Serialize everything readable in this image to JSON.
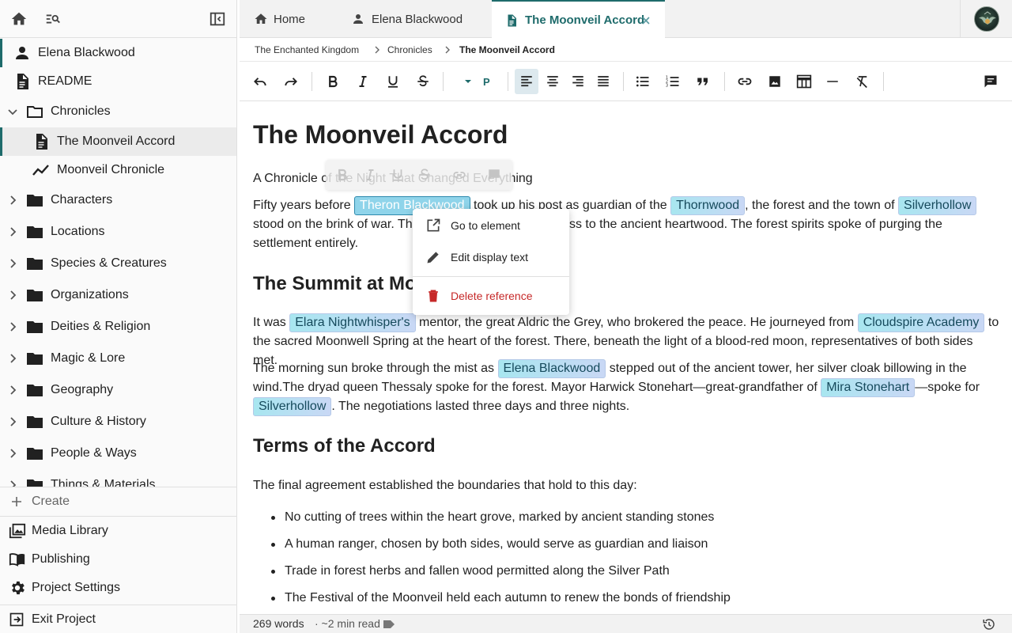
{
  "sidebar": {
    "home_icon": "home-icon",
    "search_icon": "search-tree-icon",
    "collapse_icon": "collapse-sidebar-icon",
    "items": [
      {
        "label": "Elena Blackwood",
        "icon": "person-icon"
      },
      {
        "label": "README",
        "icon": "document-icon"
      },
      {
        "label": "Chronicles",
        "icon": "folder-open-icon",
        "expanded": true
      },
      {
        "label": "The Moonveil Accord",
        "icon": "document-icon",
        "active": true
      },
      {
        "label": "Moonveil Chronicle",
        "icon": "timeline-icon"
      },
      {
        "label": "Characters",
        "icon": "folder-icon"
      },
      {
        "label": "Locations",
        "icon": "folder-icon"
      },
      {
        "label": "Species & Creatures",
        "icon": "folder-icon"
      },
      {
        "label": "Organizations",
        "icon": "folder-icon"
      },
      {
        "label": "Deities & Religion",
        "icon": "folder-icon"
      },
      {
        "label": "Magic & Lore",
        "icon": "folder-icon"
      },
      {
        "label": "Geography",
        "icon": "folder-icon"
      },
      {
        "label": "Culture & History",
        "icon": "folder-icon"
      },
      {
        "label": "People & Ways",
        "icon": "folder-icon"
      },
      {
        "label": "Things & Materials",
        "icon": "folder-icon"
      }
    ],
    "create_label": "Create",
    "bottom": [
      {
        "label": "Media Library",
        "icon": "image-library-icon"
      },
      {
        "label": "Publishing",
        "icon": "book-icon"
      },
      {
        "label": "Project Settings",
        "icon": "gear-icon"
      },
      {
        "label": "Exit Project",
        "icon": "exit-icon"
      }
    ]
  },
  "tabs": [
    {
      "label": "Home",
      "icon": "home-icon"
    },
    {
      "label": "Elena Blackwood",
      "icon": "person-icon"
    },
    {
      "label": "The Moonveil Accord",
      "icon": "document-icon",
      "active": true
    }
  ],
  "breadcrumb": [
    "The Enchanted Kingdom",
    "Chronicles",
    "The Moonveil Accord"
  ],
  "toolbar": {
    "style_value": "P",
    "buttons": [
      "undo",
      "redo",
      "bold",
      "italic",
      "underline",
      "strikethrough",
      "align-left",
      "align-center",
      "align-right",
      "align-justify",
      "bullet-list",
      "numbered-list",
      "quote",
      "link",
      "image",
      "table",
      "horizontal-rule",
      "clear-format",
      "comments"
    ],
    "active_button": "align-left"
  },
  "document": {
    "title": "The Moonveil Accord",
    "subtitle": "A Chronicle of the Night That Changed Everything",
    "p1": {
      "t1": "Fifty years before ",
      "ref1": "Theron Blackwood",
      "t2": " took up his post as guardian of the ",
      "ref2": "Thornwood",
      "t3": ", the forest and the town of ",
      "ref3": "Silverhollow",
      "t4": " stood on the brink of war. The townsfolk demanded access to the ancient heartwood. The forest spirits spoke of purging the settlement entirely."
    },
    "h2a": "The Summit at Moonwell",
    "p2": {
      "t1": "It was ",
      "ref1": "Elara Nightwhisper's",
      "t2": " mentor, the great Aldric the Grey, who brokered the peace. He journeyed from ",
      "ref2": "Cloudspire Academy",
      "t3": " to the sacred Moonwell Spring at the heart of the forest. There, beneath the light of a blood-red moon, representatives of both sides met."
    },
    "p3": {
      "t1": "The morning sun broke through the mist as ",
      "ref1": "Elena Blackwood",
      "t2": " stepped out of the ancient tower, her silver cloak billowing in the wind.The dryad queen Thessaly spoke for the forest. Mayor Harwick Stonehart—great-grandfather of ",
      "ref2": "Mira Stonehart",
      "t3": "—spoke for ",
      "ref3": "Silverhollow",
      "t4": ". The negotiations lasted three days and three nights."
    },
    "h2b": "Terms of the Accord",
    "p4": "The final agreement established the boundaries that hold to this day:",
    "bullets": [
      "No cutting of trees within the heart grove, marked by ancient standing stones",
      "A human ranger, chosen by both sides, would serve as guardian and liaison",
      "Trade in forest herbs and fallen wood permitted along the Silver Path",
      "The Festival of the Moonveil held each autumn to renew the bonds of friendship"
    ]
  },
  "context_menu": {
    "items": [
      {
        "label": "Go to element",
        "icon": "open-external-icon"
      },
      {
        "label": "Edit display text",
        "icon": "pencil-icon"
      },
      {
        "label": "Delete reference",
        "icon": "trash-icon",
        "danger": true
      }
    ]
  },
  "status": {
    "words": "269 words",
    "read_time": "· ~2 min read"
  },
  "colors": {
    "accent": "#1e6b6b",
    "reference_bg_start": "#a8e6f0",
    "reference_bg_end": "#c9d8f5",
    "danger": "#c62828"
  }
}
